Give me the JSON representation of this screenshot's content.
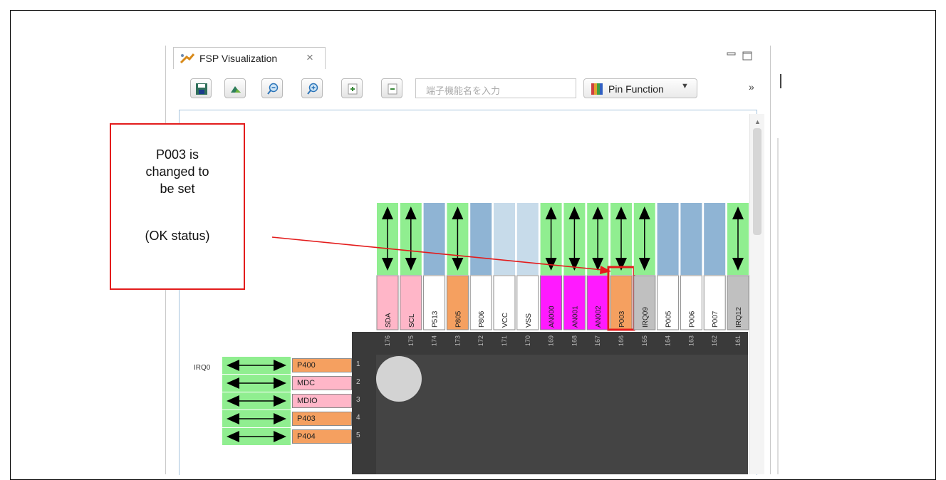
{
  "tab": {
    "title": "FSP Visualization",
    "close": "×"
  },
  "toolbar": {
    "search_placeholder": "端子機能名を入力",
    "view_select": "Pin Function",
    "more": "»"
  },
  "callout": {
    "line1": "P003 is",
    "line2": "changed to",
    "line3": "be set",
    "line4": "(OK status)"
  },
  "colors": {
    "callout_border": "#e31c1c",
    "io_green": "#90ee90",
    "pink": "#ffb6c8",
    "orange": "#f5a060",
    "magenta": "#ff1aff",
    "gray": "#c0c0c0",
    "blue": "#8fb4d4",
    "lightblue": "#c7dbea"
  },
  "top_pins": [
    {
      "number": "176",
      "label": "SDA",
      "fill": "pink",
      "direction": "bidir"
    },
    {
      "number": "175",
      "label": "SCL",
      "fill": "pink",
      "direction": "bidir"
    },
    {
      "number": "174",
      "label": "P513",
      "fill": "white",
      "direction": "none-blue"
    },
    {
      "number": "173",
      "label": "P805",
      "fill": "orange",
      "direction": "bidir"
    },
    {
      "number": "172",
      "label": "P806",
      "fill": "white",
      "direction": "none-blue"
    },
    {
      "number": "171",
      "label": "VCC",
      "fill": "white",
      "direction": "none-light"
    },
    {
      "number": "170",
      "label": "VSS",
      "fill": "white",
      "direction": "none-light"
    },
    {
      "number": "169",
      "label": "AN000",
      "fill": "magenta",
      "direction": "bidir"
    },
    {
      "number": "168",
      "label": "AN001",
      "fill": "magenta",
      "direction": "bidir"
    },
    {
      "number": "167",
      "label": "AN002",
      "fill": "magenta",
      "direction": "bidir"
    },
    {
      "number": "166",
      "label": "P003",
      "fill": "orange",
      "direction": "bidir",
      "highlight": true
    },
    {
      "number": "165",
      "label": "IRQ09",
      "fill": "gray",
      "direction": "bidir"
    },
    {
      "number": "164",
      "label": "P005",
      "fill": "white",
      "direction": "none-blue"
    },
    {
      "number": "163",
      "label": "P006",
      "fill": "white",
      "direction": "none-blue"
    },
    {
      "number": "162",
      "label": "P007",
      "fill": "white",
      "direction": "none-blue"
    },
    {
      "number": "161",
      "label": "IRQ12",
      "fill": "gray",
      "direction": "bidir"
    }
  ],
  "left_pins": [
    {
      "number": "1",
      "label": "P400",
      "fill": "orange",
      "signal": "IRQ0"
    },
    {
      "number": "2",
      "label": "MDC",
      "fill": "pink",
      "signal": ""
    },
    {
      "number": "3",
      "label": "MDIO",
      "fill": "pink",
      "signal": ""
    },
    {
      "number": "4",
      "label": "P403",
      "fill": "orange",
      "signal": ""
    },
    {
      "number": "5",
      "label": "P404",
      "fill": "orange",
      "signal": ""
    }
  ]
}
